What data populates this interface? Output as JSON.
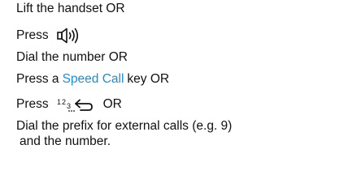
{
  "instructions": {
    "line1": "Lift the handset OR",
    "line2_prefix": "Press",
    "line2_icon": "speaker-icon",
    "line3": "Dial the number OR",
    "line4_prefix": "Press a",
    "line4_highlight": "Speed Call",
    "line4_suffix": "key OR",
    "line5_prefix": "Press",
    "line5_icon": "redial-icon",
    "line5_icon_text": "123",
    "line5_suffix": "OR",
    "line6": "Dial the prefix for external calls (e.g. 9)",
    "line7": "and the number."
  },
  "colors": {
    "text": "#111111",
    "highlight": "#1a8fd6"
  }
}
